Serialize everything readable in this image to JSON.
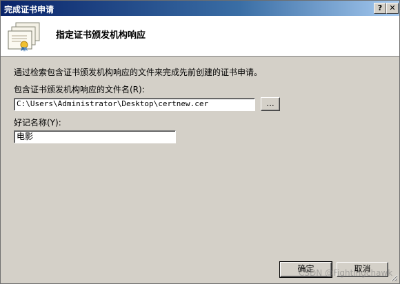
{
  "window": {
    "title": "完成证书申请",
    "help_label": "?",
    "close_label": "✕"
  },
  "header": {
    "title": "指定证书颁发机构响应",
    "icon": "certificate-icon"
  },
  "content": {
    "description": "通过检索包含证书颁发机构响应的文件来完成先前创建的证书申请。",
    "file_label": "包含证书颁发机构响应的文件名(R):",
    "file_value": "C:\\Users\\Administrator\\Desktop\\certnew.cer",
    "browse_label": "...",
    "name_label": "好记名称(Y):",
    "name_value": "电影"
  },
  "buttons": {
    "ok": "确定",
    "cancel": "取消"
  },
  "watermark": "CSDN @Fightingchawk",
  "colors": {
    "title_start": "#0a246a",
    "title_end": "#a6caf0",
    "face": "#d4d0c8"
  }
}
